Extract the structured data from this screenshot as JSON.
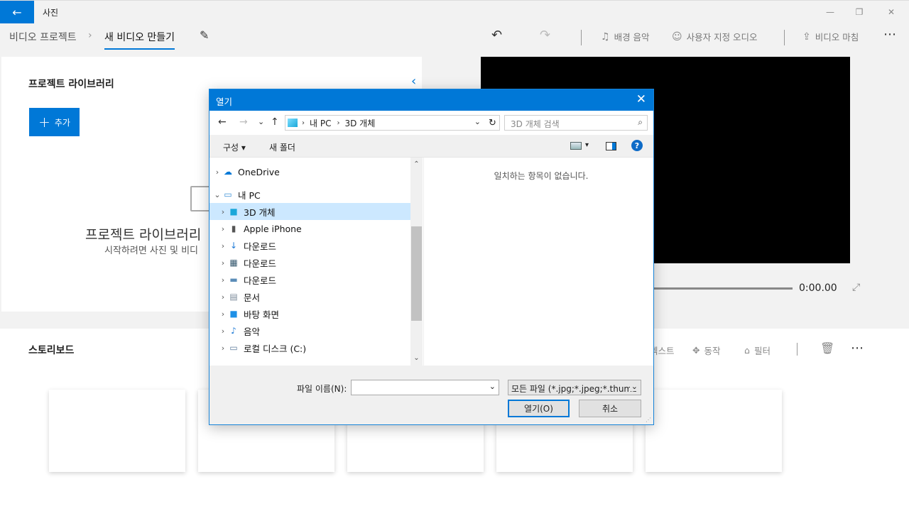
{
  "app": {
    "title": "사진",
    "back_icon": "←"
  },
  "window_controls": {
    "minimize": "—",
    "restore": "❐",
    "close": "✕"
  },
  "breadcrumb": {
    "parent": "비디오 프로젝트",
    "separator": "›",
    "current": "새 비디오 만들기"
  },
  "toolbar": {
    "rename_icon": "✎",
    "undo_icon": "↶",
    "redo_icon": "↷",
    "background_music": "배경 음악",
    "custom_audio": "사용자 지정 오디오",
    "finish_video": "비디오 마침",
    "more": "⋯"
  },
  "library": {
    "title": "프로젝트 라이브러리",
    "add_label": "추가",
    "empty_title": "프로젝트 라이브러리",
    "empty_subtitle": "시작하려면 사진 및 비디"
  },
  "preview": {
    "timecode": "0:00.00"
  },
  "storyboard": {
    "title": "스토리보드",
    "text_action": "텍스트",
    "motion_action": "동작",
    "filter_action": "필터",
    "slots": 5
  },
  "dialog": {
    "title": "열기",
    "close": "✕",
    "nav": {
      "back": "←",
      "forward": "→",
      "recent": "⌄",
      "up": "↑"
    },
    "address": [
      "내 PC",
      "3D 개체"
    ],
    "search_placeholder": "3D 개체 검색",
    "organize": "구성 ▾",
    "new_folder": "새 폴더",
    "help": "?",
    "tree": [
      {
        "label": "OneDrive",
        "icon": "cloud-icon",
        "glyph": "☁",
        "color": "#0078d7",
        "indent": 1,
        "expanded": false
      },
      {
        "label": "내 PC",
        "icon": "pc-icon",
        "glyph": "▭",
        "color": "#3a8fd6",
        "indent": 1,
        "expanded": true
      },
      {
        "label": "3D 개체",
        "icon": "3d-objects-icon",
        "glyph": "■",
        "color": "#1aa7d9",
        "indent": 2,
        "selected": true
      },
      {
        "label": "Apple iPhone",
        "icon": "iphone-icon",
        "glyph": "▮",
        "color": "#555555",
        "indent": 2
      },
      {
        "label": "다운로드",
        "icon": "download-icon",
        "glyph": "↓",
        "color": "#1e7ad6",
        "indent": 2
      },
      {
        "label": "다운로드",
        "icon": "film-icon",
        "glyph": "▦",
        "color": "#35586e",
        "indent": 2
      },
      {
        "label": "다운로드",
        "icon": "pictures-icon",
        "glyph": "▬",
        "color": "#5b8db8",
        "indent": 2
      },
      {
        "label": "문서",
        "icon": "document-icon",
        "glyph": "▤",
        "color": "#7a8a99",
        "indent": 2
      },
      {
        "label": "바탕 화면",
        "icon": "desktop-icon",
        "glyph": "■",
        "color": "#1e90e6",
        "indent": 2
      },
      {
        "label": "음악",
        "icon": "music-icon",
        "glyph": "♪",
        "color": "#1e7ad6",
        "indent": 2
      },
      {
        "label": "로컬 디스크 (C:)",
        "icon": "drive-icon",
        "glyph": "▭",
        "color": "#5a7a9a",
        "indent": 2
      }
    ],
    "empty_message": "일치하는 항목이 없습니다.",
    "filename_label": "파일 이름(N):",
    "filename_value": "",
    "filter_value": "모든 파일 (*.jpg;*.jpeg;*.thumb",
    "open_button": "열기(O)",
    "cancel_button": "취소"
  }
}
